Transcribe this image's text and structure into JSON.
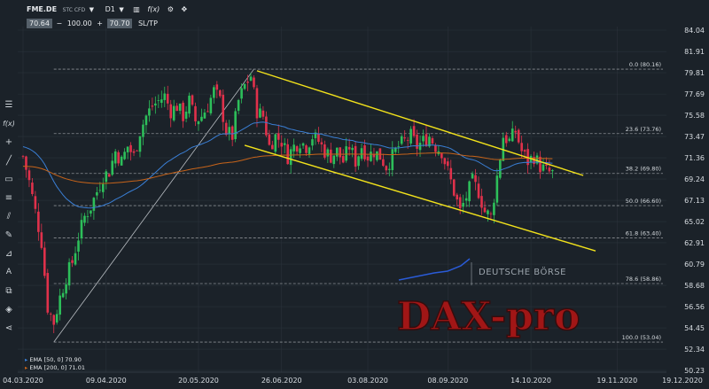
{
  "toolbar": {
    "symbol": "FME.DE",
    "instrument_type": "STC CFD",
    "timeframe": "D1",
    "bid": "70.64",
    "quantity": "100.00",
    "ask": "70.70",
    "sltp_label": "SL/TP"
  },
  "legend": {
    "ema50": "EMA [50, 0] 70.90",
    "ema200": "EMA [200, 0] 71.01"
  },
  "watermark": {
    "exchange": "DEUTSCHE BÖRSE",
    "brand": "DAX-pro"
  },
  "colors": {
    "background": "#1b2229",
    "up": "#2dbf5a",
    "down": "#e0314b",
    "ema50": "#3a7fd5",
    "ema200": "#c8641a",
    "channel": "#f2e21b",
    "fib_line": "#8a8f94",
    "grid": "#2a323a",
    "axis_text": "#d8dde2",
    "watermark_brand": "#d11818"
  },
  "chart_data": {
    "type": "candlestick",
    "timeframe": "D1",
    "y_range": [
      50.23,
      85.1
    ],
    "y_ticks": [
      "84.04",
      "81.91",
      "79.81",
      "77.69",
      "75.58",
      "73.47",
      "71.36",
      "69.24",
      "67.13",
      "65.02",
      "62.91",
      "60.79",
      "58.68",
      "56.56",
      "54.45",
      "52.34",
      "50.23"
    ],
    "x_ticks": [
      "04.03.2020",
      "09.04.2020",
      "20.05.2020",
      "26.06.2020",
      "03.08.2020",
      "08.09.2020",
      "14.10.2020",
      "19.11.2020",
      "19.12.2020"
    ],
    "x_range_bars": [
      0,
      205
    ],
    "fibonacci": [
      {
        "label": "0.0 (80.16)",
        "value": 80.16
      },
      {
        "label": "23.6 (73.76)",
        "value": 73.76
      },
      {
        "label": "38.2 (69.80)",
        "value": 69.8
      },
      {
        "label": "50.0 (66.60)",
        "value": 66.6
      },
      {
        "label": "61.8 (63.40)",
        "value": 63.4
      },
      {
        "label": "78.6 (58.86)",
        "value": 58.86
      },
      {
        "label": "100.0 (53.04)",
        "value": 53.04
      }
    ],
    "fib_anchor": {
      "from": {
        "bar": 10,
        "value": 53.04
      },
      "to": {
        "bar": 75,
        "value": 80.16
      }
    },
    "channel_upper": {
      "from": {
        "bar": 76,
        "value": 80.0
      },
      "to": {
        "bar": 182,
        "value": 69.6
      }
    },
    "channel_lower": {
      "from": {
        "bar": 72,
        "value": 72.6
      },
      "to": {
        "bar": 186,
        "value": 62.1
      }
    },
    "ema50_last": 70.9,
    "ema200_last": 71.01,
    "close_path": [
      [
        0,
        71.5
      ],
      [
        2,
        69.0
      ],
      [
        4,
        66.0
      ],
      [
        6,
        63.0
      ],
      [
        8,
        56.5
      ],
      [
        10,
        55.0
      ],
      [
        12,
        57.5
      ],
      [
        14,
        59.5
      ],
      [
        16,
        61.0
      ],
      [
        18,
        63.5
      ],
      [
        20,
        65.5
      ],
      [
        22,
        66.5
      ],
      [
        24,
        68.0
      ],
      [
        26,
        69.5
      ],
      [
        28,
        70.0
      ],
      [
        30,
        72.0
      ],
      [
        32,
        71.0
      ],
      [
        34,
        72.5
      ],
      [
        36,
        71.5
      ],
      [
        38,
        74.0
      ],
      [
        40,
        75.5
      ],
      [
        42,
        76.5
      ],
      [
        44,
        77.0
      ],
      [
        46,
        77.5
      ],
      [
        48,
        76.0
      ],
      [
        50,
        76.5
      ],
      [
        52,
        75.5
      ],
      [
        54,
        77.0
      ],
      [
        56,
        75.0
      ],
      [
        58,
        75.5
      ],
      [
        60,
        76.5
      ],
      [
        62,
        78.0
      ],
      [
        64,
        77.0
      ],
      [
        66,
        74.0
      ],
      [
        68,
        73.5
      ],
      [
        70,
        77.0
      ],
      [
        72,
        78.5
      ],
      [
        74,
        79.5
      ],
      [
        76,
        76.0
      ],
      [
        78,
        75.5
      ],
      [
        80,
        72.5
      ],
      [
        82,
        73.5
      ],
      [
        84,
        73.0
      ],
      [
        86,
        71.5
      ],
      [
        88,
        72.5
      ],
      [
        90,
        73.0
      ],
      [
        92,
        72.5
      ],
      [
        94,
        73.5
      ],
      [
        96,
        73.0
      ],
      [
        98,
        72.0
      ],
      [
        100,
        71.5
      ],
      [
        102,
        72.0
      ],
      [
        104,
        71.0
      ],
      [
        106,
        72.5
      ],
      [
        108,
        71.0
      ],
      [
        110,
        72.5
      ],
      [
        112,
        71.5
      ],
      [
        114,
        72.0
      ],
      [
        116,
        71.5
      ],
      [
        118,
        70.5
      ],
      [
        120,
        71.5
      ],
      [
        122,
        72.5
      ],
      [
        124,
        73.0
      ],
      [
        126,
        73.5
      ],
      [
        128,
        72.5
      ],
      [
        130,
        73.0
      ],
      [
        132,
        73.5
      ],
      [
        134,
        72.5
      ],
      [
        136,
        72.0
      ],
      [
        138,
        70.0
      ],
      [
        140,
        68.0
      ],
      [
        142,
        66.0
      ],
      [
        144,
        67.5
      ],
      [
        146,
        69.0
      ],
      [
        148,
        68.0
      ],
      [
        150,
        66.0
      ],
      [
        152,
        65.5
      ],
      [
        154,
        69.5
      ],
      [
        156,
        73.5
      ],
      [
        158,
        73.0
      ],
      [
        160,
        74.0
      ],
      [
        162,
        72.0
      ],
      [
        164,
        71.0
      ],
      [
        166,
        71.5
      ],
      [
        168,
        70.5
      ],
      [
        170,
        70.0
      ],
      [
        172,
        69.8
      ]
    ]
  }
}
